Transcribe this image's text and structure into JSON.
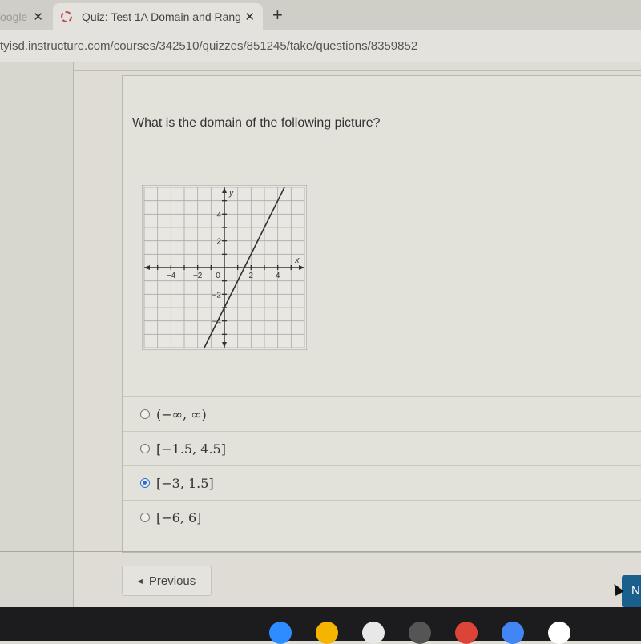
{
  "browser": {
    "tabs": [
      {
        "label": "oogle",
        "active": false
      },
      {
        "label": "Quiz: Test 1A Domain and Rang",
        "active": true
      }
    ],
    "new_tab_label": "+",
    "close_glyph": "✕",
    "url": "tyisd.instructure.com/courses/342510/quizzes/851245/take/questions/8359852"
  },
  "quiz": {
    "question": "What is the domain of the following picture?",
    "graph": {
      "x_axis_label": "x",
      "y_axis_label": "y",
      "x_ticks": [
        "−4",
        "−2",
        "0",
        "2",
        "4"
      ],
      "y_ticks": [
        "4",
        "2",
        "−2",
        "−4"
      ],
      "line": {
        "slope": 2,
        "intercept": -3,
        "x_from": -1.5,
        "x_to": 4.5
      },
      "range": [
        -6,
        6
      ]
    },
    "answers": [
      {
        "label": "(−∞, ∞)",
        "selected": false
      },
      {
        "label": "[−1.5, 4.5]",
        "selected": false
      },
      {
        "label": "[−3, 1.5]",
        "selected": true
      },
      {
        "label": "[−6, 6]",
        "selected": false
      }
    ],
    "previous_label": "Previous",
    "next_label": "N"
  },
  "taskbar": {
    "apps": [
      "zoom-icon",
      "google-drive-icon",
      "shopping-icon",
      "camera-icon",
      "chrome-icon",
      "google-docs-icon",
      "play-store-icon"
    ],
    "colors": [
      "#2d8cff",
      "#f4b400",
      "#e8e8e8",
      "#555555",
      "#db4437",
      "#4285f4",
      "#ffffff"
    ]
  }
}
